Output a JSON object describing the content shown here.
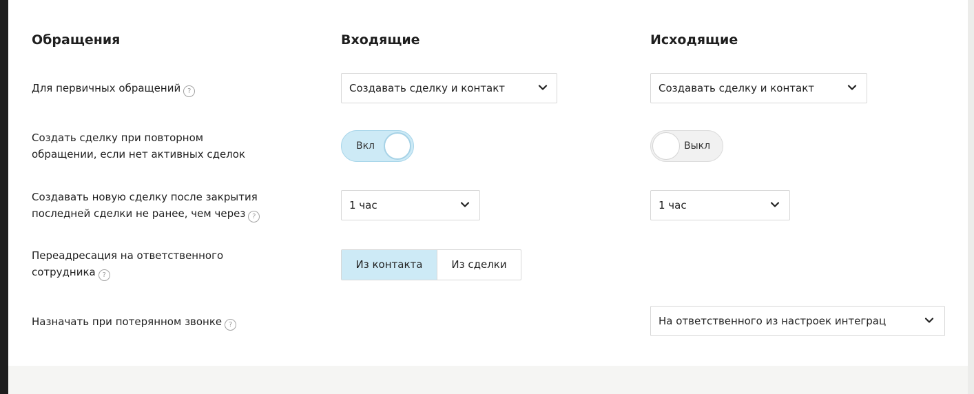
{
  "columns": {
    "section": "Обращения",
    "incoming": "Входящие",
    "outgoing": "Исходящие"
  },
  "rows": {
    "primary": {
      "label": "Для первичных обращений",
      "incoming_value": "Создавать сделку и контакт",
      "outgoing_value": "Создавать сделку и контакт"
    },
    "repeat": {
      "label_line1": "Создать сделку при повторном",
      "label_line2": "обращении, если нет активных сделок",
      "incoming_toggle": "Вкл",
      "outgoing_toggle": "Выкл",
      "incoming_state": "on",
      "outgoing_state": "off"
    },
    "new_deal_delay": {
      "label_line1": "Создавать новую сделку после закрытия",
      "label_line2": "последней сделки не ранее, чем через",
      "incoming_value": "1 час",
      "outgoing_value": "1 час"
    },
    "redirect": {
      "label_line1": "Переадресация на ответственного",
      "label_line2": "сотрудника",
      "options": [
        "Из контакта",
        "Из сделки"
      ],
      "selected": "Из контакта"
    },
    "missed_call": {
      "label": "Назначать при потерянном звонке",
      "outgoing_value": "На ответственного из настроек интеграц"
    }
  },
  "help_glyph": "?",
  "icons": {
    "help": "question-circle-icon",
    "dropdown": "chevron-down-icon"
  },
  "colors": {
    "toggle_on": "#cdeaf6",
    "segment_active": "#cdeaf6",
    "border": "#d7d7d7",
    "footer": "#f5f5f3"
  }
}
